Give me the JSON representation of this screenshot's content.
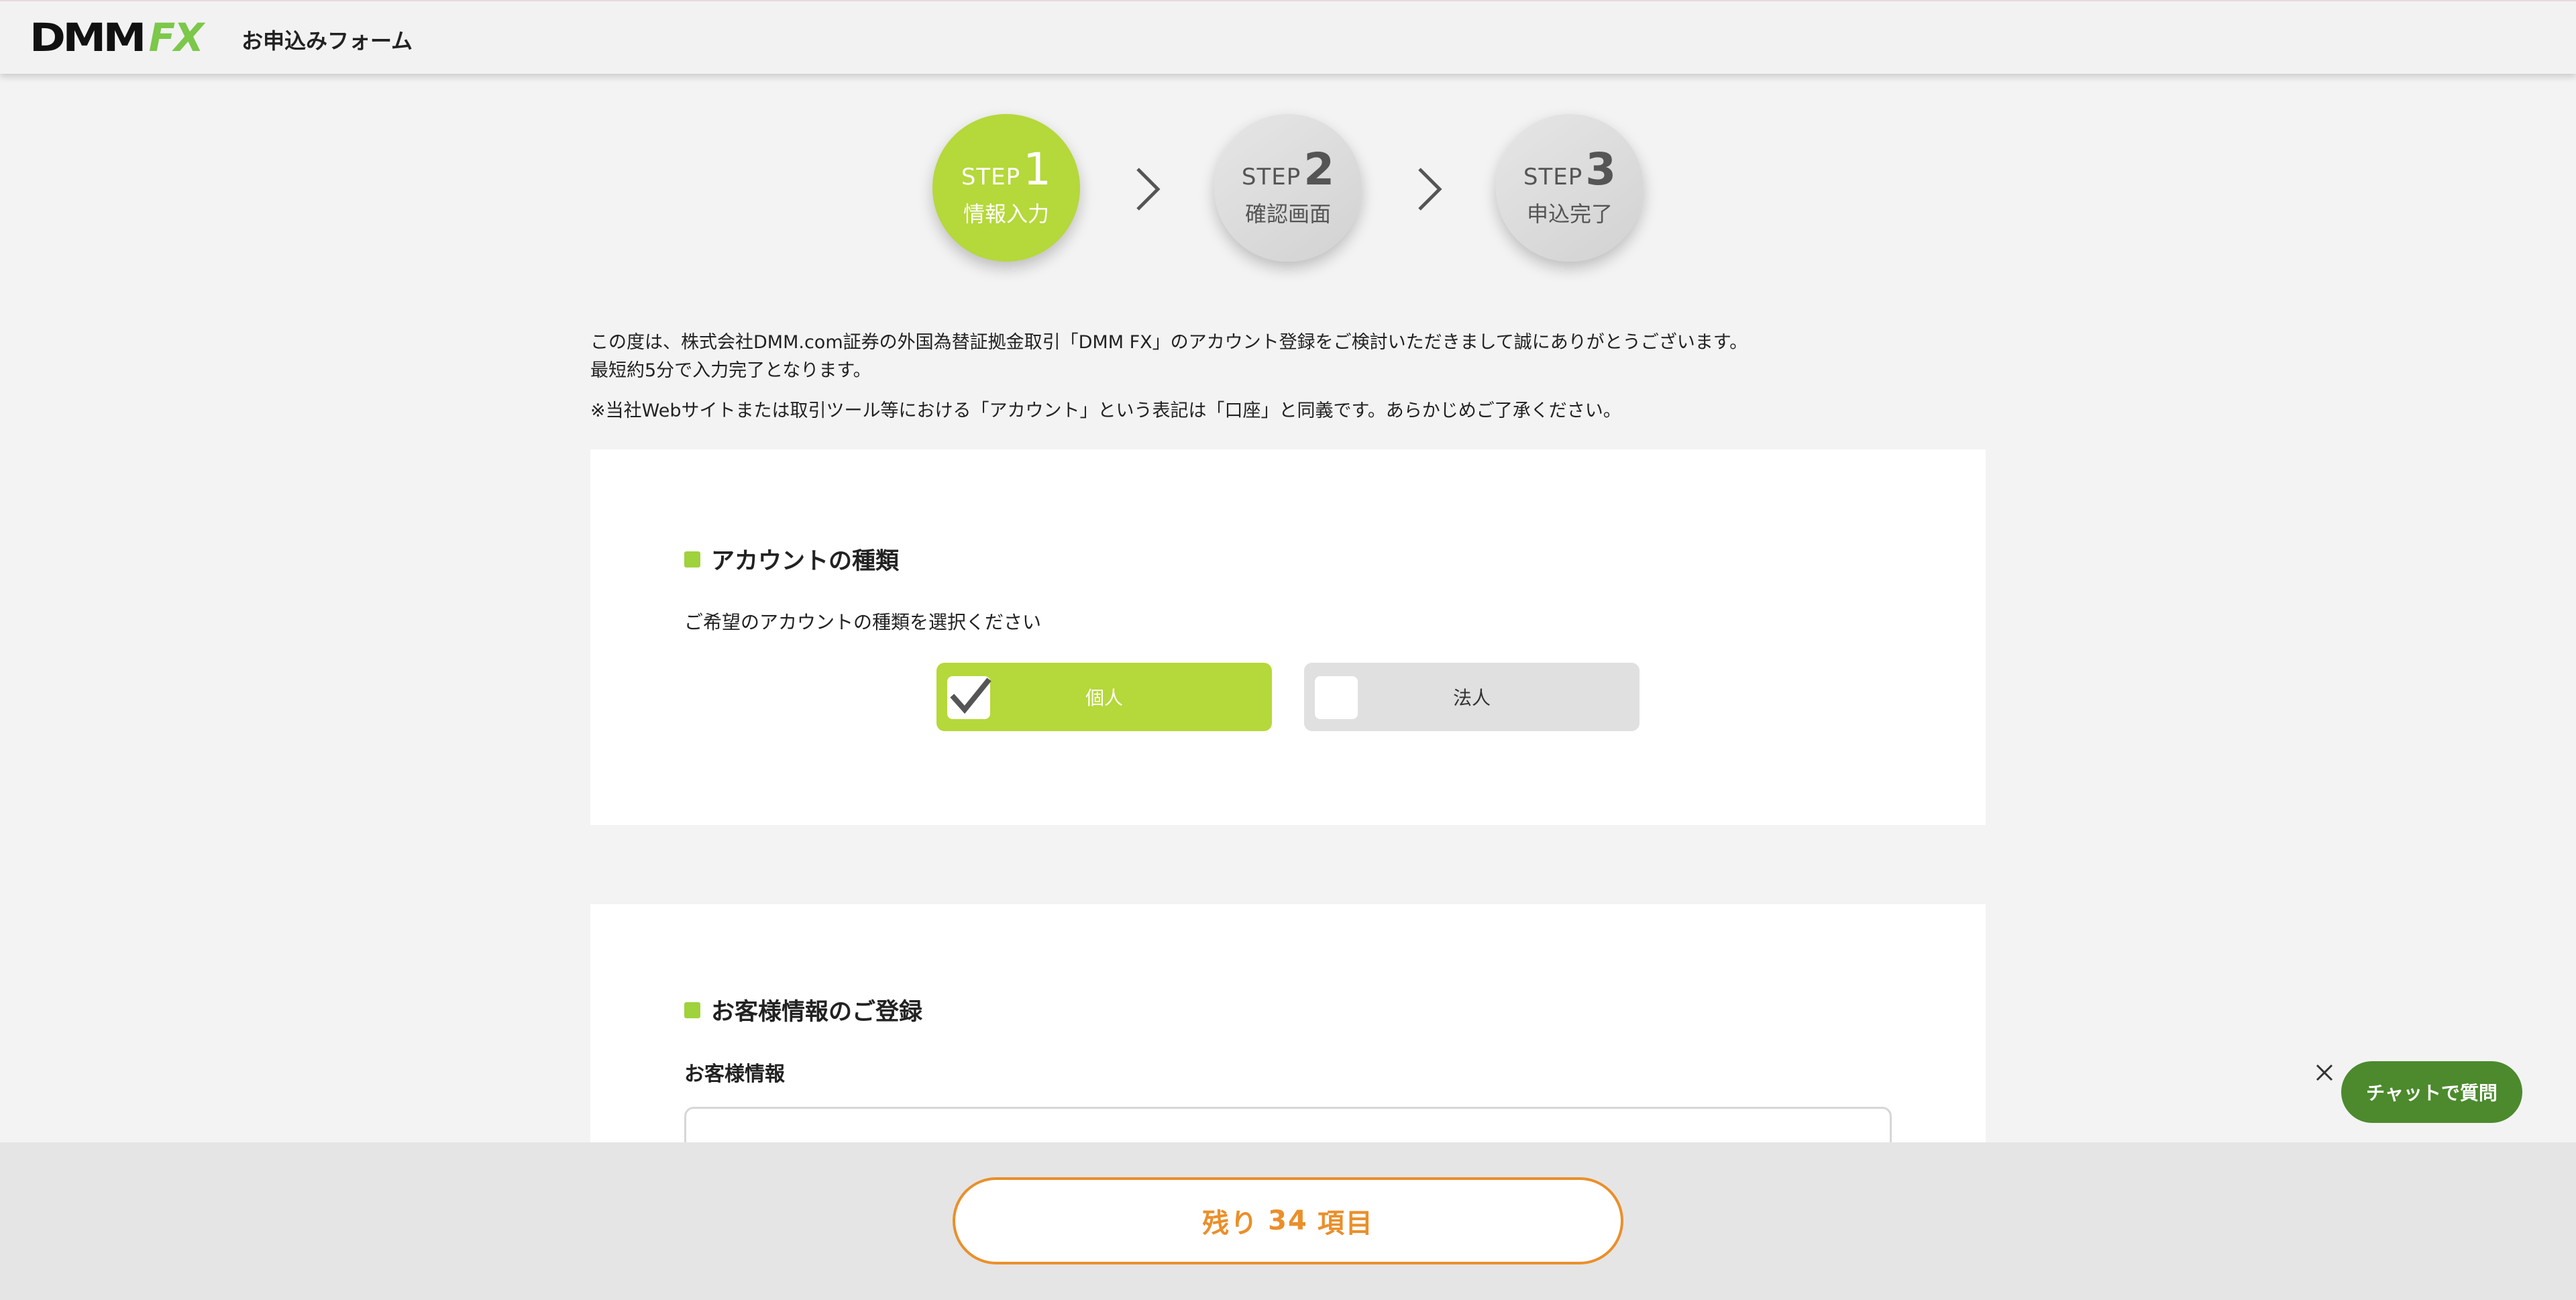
{
  "header": {
    "logo_dmm": "DMM",
    "logo_fx": "FX",
    "title": "お申込みフォーム"
  },
  "steps": [
    {
      "word": "STEP",
      "num": "1",
      "label": "情報入力",
      "active": true
    },
    {
      "word": "STEP",
      "num": "2",
      "label": "確認画面",
      "active": false
    },
    {
      "word": "STEP",
      "num": "3",
      "label": "申込完了",
      "active": false
    }
  ],
  "intro": {
    "line1": "この度は、株式会社DMM.com証券の外国為替証拠金取引「DMM FX」のアカウント登録をご検討いただきまして誠にありがとうございます。",
    "line2": "最短約5分で入力完了となります。",
    "note": "※当社Webサイトまたは取引ツール等における「アカウント」という表記は「口座」と同義です。あらかじめご了承ください。"
  },
  "account_type": {
    "title": "アカウントの種類",
    "description": "ご希望のアカウントの種類を選択ください",
    "options": [
      {
        "label": "個人",
        "selected": true
      },
      {
        "label": "法人",
        "selected": false
      }
    ]
  },
  "customer": {
    "title": "お客様情報のご登録",
    "subtitle": "お客様情報"
  },
  "chat": {
    "label": "チャットで質問"
  },
  "bottom": {
    "remaining_prefix": "残り",
    "remaining_count": "34",
    "remaining_suffix": "項目"
  },
  "colors": {
    "accent_green": "#b5d83a",
    "chat_green": "#4c8a2d",
    "orange": "#ea8f2a"
  }
}
